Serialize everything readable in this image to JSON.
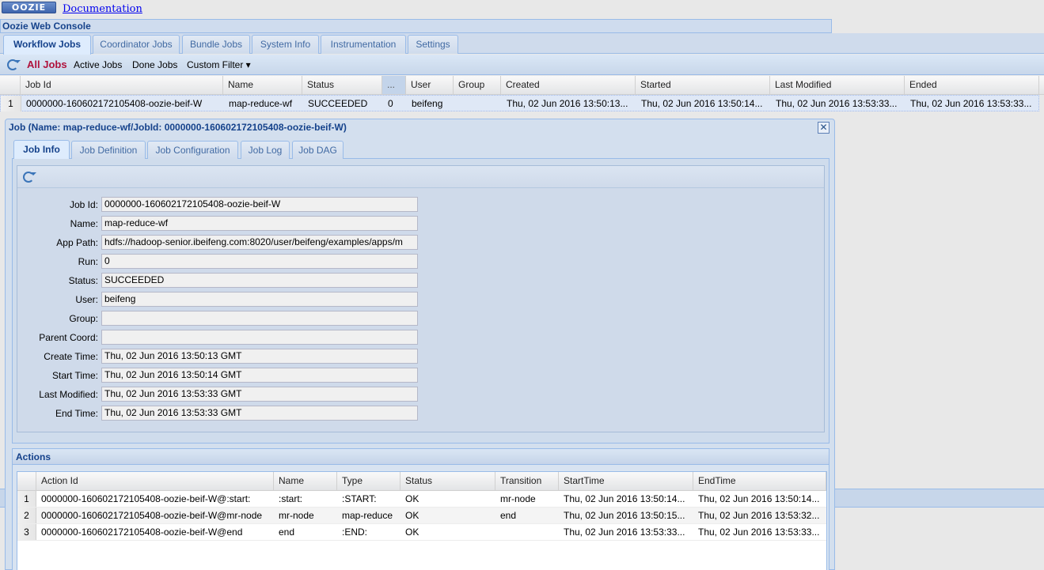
{
  "logo": "OOZIE",
  "doc_link": "Documentation",
  "console_title": "Oozie Web Console",
  "main_tabs": [
    "Workflow Jobs",
    "Coordinator Jobs",
    "Bundle Jobs",
    "System Info",
    "Instrumentation",
    "Settings"
  ],
  "toolbar": {
    "all_jobs": "All Jobs",
    "active_jobs": "Active Jobs",
    "done_jobs": "Done Jobs",
    "custom_filter": "Custom Filter ▾"
  },
  "jobs_grid": {
    "headers": [
      "Job Id",
      "Name",
      "Status",
      "...",
      "User",
      "Group",
      "Created",
      "Started",
      "Last Modified",
      "Ended"
    ],
    "rows": [
      {
        "num": "1",
        "job_id": "0000000-160602172105408-oozie-beif-W",
        "name": "map-reduce-wf",
        "status": "SUCCEEDED",
        "run": "0",
        "user": "beifeng",
        "group": "",
        "created": "Thu, 02 Jun 2016 13:50:13...",
        "started": "Thu, 02 Jun 2016 13:50:14...",
        "last_modified": "Thu, 02 Jun 2016 13:53:33...",
        "ended": "Thu, 02 Jun 2016 13:53:33..."
      }
    ]
  },
  "job_window": {
    "title": "Job (Name: map-reduce-wf/JobId: 0000000-160602172105408-oozie-beif-W)",
    "tabs": [
      "Job Info",
      "Job Definition",
      "Job Configuration",
      "Job Log",
      "Job DAG"
    ],
    "fields": [
      {
        "label": "Job Id:",
        "value": "0000000-160602172105408-oozie-beif-W"
      },
      {
        "label": "Name:",
        "value": "map-reduce-wf"
      },
      {
        "label": "App Path:",
        "value": "hdfs://hadoop-senior.ibeifeng.com:8020/user/beifeng/examples/apps/m"
      },
      {
        "label": "Run:",
        "value": "0"
      },
      {
        "label": "Status:",
        "value": "SUCCEEDED"
      },
      {
        "label": "User:",
        "value": "beifeng"
      },
      {
        "label": "Group:",
        "value": ""
      },
      {
        "label": "Parent Coord:",
        "value": ""
      },
      {
        "label": "Create Time:",
        "value": "Thu, 02 Jun 2016 13:50:13 GMT"
      },
      {
        "label": "Start Time:",
        "value": "Thu, 02 Jun 2016 13:50:14 GMT"
      },
      {
        "label": "Last Modified:",
        "value": "Thu, 02 Jun 2016 13:53:33 GMT"
      },
      {
        "label": "End Time:",
        "value": "Thu, 02 Jun 2016 13:53:33 GMT"
      }
    ]
  },
  "actions": {
    "title": "Actions",
    "headers": [
      "Action Id",
      "Name",
      "Type",
      "Status",
      "Transition",
      "StartTime",
      "EndTime"
    ],
    "rows": [
      {
        "num": "1",
        "id": "0000000-160602172105408-oozie-beif-W@:start:",
        "name": ":start:",
        "type": ":START:",
        "status": "OK",
        "transition": "mr-node",
        "start": "Thu, 02 Jun 2016 13:50:14...",
        "end": "Thu, 02 Jun 2016 13:50:14..."
      },
      {
        "num": "2",
        "id": "0000000-160602172105408-oozie-beif-W@mr-node",
        "name": "mr-node",
        "type": "map-reduce",
        "status": "OK",
        "transition": "end",
        "start": "Thu, 02 Jun 2016 13:50:15...",
        "end": "Thu, 02 Jun 2016 13:53:32..."
      },
      {
        "num": "3",
        "id": "0000000-160602172105408-oozie-beif-W@end",
        "name": "end",
        "type": ":END:",
        "status": "OK",
        "transition": "",
        "start": "Thu, 02 Jun 2016 13:53:33...",
        "end": "Thu, 02 Jun 2016 13:53:33..."
      }
    ]
  },
  "colors": {
    "accent": "#15428b",
    "active_filter": "#b0123c",
    "border": "#99bbe8"
  }
}
